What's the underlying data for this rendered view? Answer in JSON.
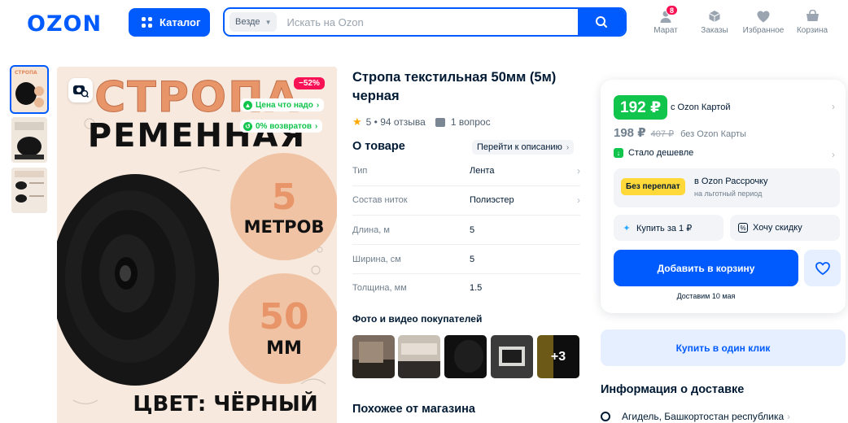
{
  "header": {
    "logo": "OZON",
    "catalog_label": "Каталог",
    "search_scope": "Везде",
    "search_placeholder": "Искать на Ozon",
    "nav": [
      {
        "label": "Марат",
        "icon": "user-icon",
        "badge": "8"
      },
      {
        "label": "Заказы",
        "icon": "box-icon"
      },
      {
        "label": "Избранное",
        "icon": "heart-icon"
      },
      {
        "label": "Корзина",
        "icon": "cart-icon"
      }
    ]
  },
  "gallery": {
    "discount_badge": "−52%",
    "chips": [
      "Цена что надо",
      "0% возвратов"
    ],
    "image_text": {
      "line1": "СТРОПА",
      "line2": "РЕМЕННАЯ",
      "length_num": "5",
      "length_unit": "МЕТРОВ",
      "width_num": "50",
      "width_unit": "ММ",
      "color": "ЦВЕТ: ЧЁРНЫЙ"
    },
    "thumb_count": 3
  },
  "product": {
    "title": "Стропа текстильная 50мм (5м) черная",
    "rating": "5 • 94 отзыва",
    "questions": "1 вопрос",
    "about_heading": "О товаре",
    "to_description": "Перейти к описанию",
    "specs": [
      {
        "key": "Тип",
        "value": "Лента",
        "link": true
      },
      {
        "key": "Состав ниток",
        "value": "Полиэстер",
        "link": true
      },
      {
        "key": "Длина, м",
        "value": "5",
        "link": false
      },
      {
        "key": "Ширина, см",
        "value": "5",
        "link": false
      },
      {
        "key": "Толщина, мм",
        "value": "1.5",
        "link": false
      }
    ],
    "photos_heading": "Фото и видео покупателей",
    "photos_more": "+3",
    "similar_heading": "Похожее от магазина"
  },
  "buy": {
    "price_card": "192 ₽",
    "price_card_label": "с Ozon Картой",
    "price_regular": "198 ₽",
    "price_old": "407 ₽",
    "price_regular_label": "без Ozon Карты",
    "cheaper": "Стало дешевле",
    "installment_tag": "Без переплат",
    "installment_title": "в Ozon Рассрочку",
    "installment_sub": "на льготный период",
    "buy_for_1": "Купить за 1 ₽",
    "want_discount": "Хочу скидку",
    "add_to_cart": "Добавить в корзину",
    "delivery_date": "Доставим 10 мая",
    "one_click": "Купить в один клик",
    "delivery_heading": "Информация о доставке",
    "city": "Агидель, Башкортостан республика"
  },
  "colors": {
    "brand": "#005bff",
    "green": "#10c44c",
    "pink": "#f91155",
    "orange_text": "#e8956a"
  }
}
